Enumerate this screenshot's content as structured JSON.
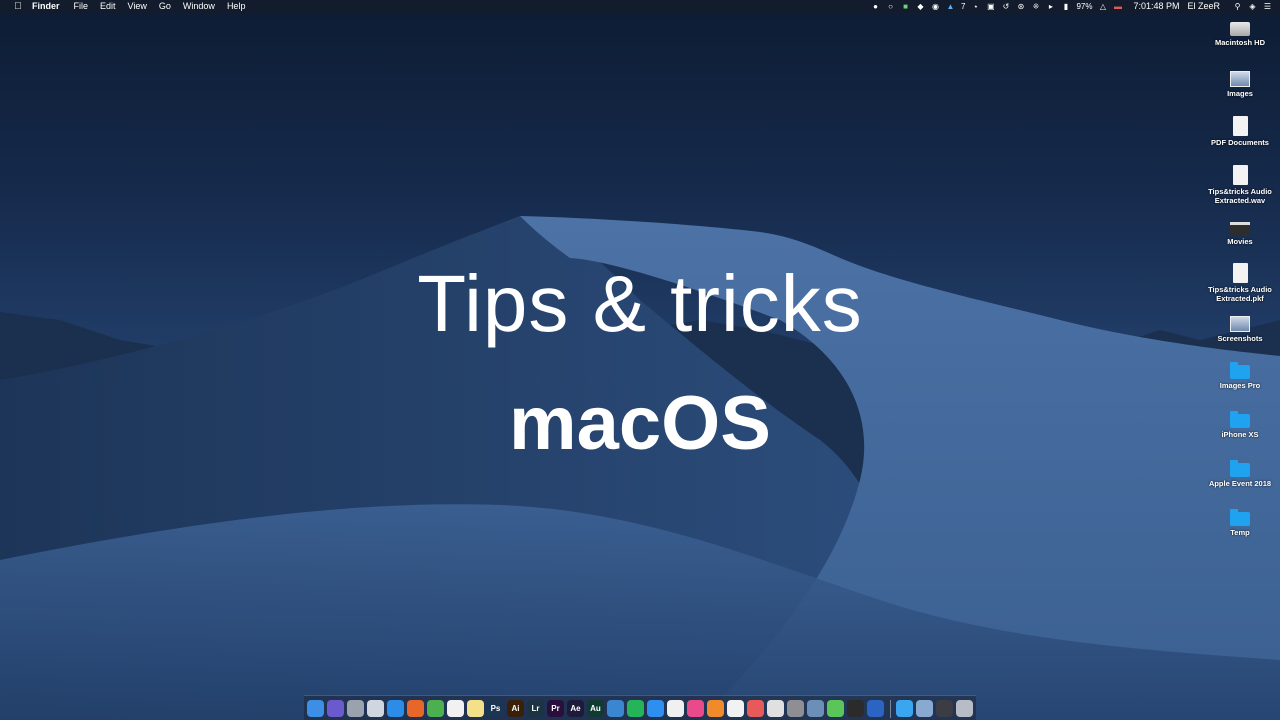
{
  "menubar": {
    "app_name": "Finder",
    "menus": [
      "File",
      "Edit",
      "View",
      "Go",
      "Window",
      "Help"
    ],
    "status": {
      "badge_count": "7",
      "battery_percent": "97%",
      "time": "7:01:48 PM",
      "user": "El ZeeR"
    }
  },
  "headline": {
    "line1": "Tips & tricks",
    "line2": "macOS"
  },
  "desktop_icons": [
    {
      "label": "Macintosh HD",
      "icon": "drive-icon"
    },
    {
      "label": "Images",
      "icon": "image-icon"
    },
    {
      "label": "PDF Documents",
      "icon": "document-icon"
    },
    {
      "label": "Tips&tricks Audio Extracted.wav",
      "icon": "audio-file-icon"
    },
    {
      "label": "Movies",
      "icon": "movie-icon"
    },
    {
      "label": "Tips&tricks Audio Extracted.pkf",
      "icon": "document-icon"
    },
    {
      "label": "Screenshots",
      "icon": "screenshot-icon"
    },
    {
      "label": "Images Pro",
      "icon": "folder-icon"
    },
    {
      "label": "iPhone XS",
      "icon": "folder-icon"
    },
    {
      "label": "Apple Event 2018",
      "icon": "folder-icon"
    },
    {
      "label": "Temp",
      "icon": "folder-icon"
    }
  ],
  "dock": {
    "apps": [
      {
        "name": "finder",
        "color": "#3d8fe6",
        "text": ""
      },
      {
        "name": "siri",
        "color": "#6a5acd",
        "text": ""
      },
      {
        "name": "launchpad",
        "color": "#9aa3ad",
        "text": ""
      },
      {
        "name": "mail",
        "color": "#d0d6df",
        "text": ""
      },
      {
        "name": "safari",
        "color": "#2c8de8",
        "text": ""
      },
      {
        "name": "firefox",
        "color": "#e8662a",
        "text": ""
      },
      {
        "name": "chrome",
        "color": "#4caf50",
        "text": ""
      },
      {
        "name": "calendar",
        "color": "#f1f1f1",
        "text": ""
      },
      {
        "name": "notes",
        "color": "#f5e08a",
        "text": ""
      },
      {
        "name": "photoshop",
        "color": "#1b3553",
        "text": "Ps"
      },
      {
        "name": "illustrator",
        "color": "#3b2009",
        "text": "Ai"
      },
      {
        "name": "lightroom",
        "color": "#1c3344",
        "text": "Lr"
      },
      {
        "name": "premiere",
        "color": "#2a0f3d",
        "text": "Pr"
      },
      {
        "name": "after-effects",
        "color": "#1e1a3b",
        "text": "Ae"
      },
      {
        "name": "audition",
        "color": "#0f3b33",
        "text": "Au"
      },
      {
        "name": "tweetbot",
        "color": "#3b86d1",
        "text": ""
      },
      {
        "name": "whatsapp",
        "color": "#25b45a",
        "text": ""
      },
      {
        "name": "app-store",
        "color": "#2f8ff0",
        "text": ""
      },
      {
        "name": "photos",
        "color": "#f0f0f0",
        "text": ""
      },
      {
        "name": "itunes",
        "color": "#e94a8a",
        "text": ""
      },
      {
        "name": "books",
        "color": "#f08a2a",
        "text": ""
      },
      {
        "name": "reminders",
        "color": "#f2f2f2",
        "text": ""
      },
      {
        "name": "skitch",
        "color": "#e85a5a",
        "text": ""
      },
      {
        "name": "preview",
        "color": "#e0e0e0",
        "text": ""
      },
      {
        "name": "system-preferences",
        "color": "#8e8e93",
        "text": ""
      },
      {
        "name": "finder-extras",
        "color": "#6c8fb8",
        "text": ""
      },
      {
        "name": "messages",
        "color": "#5ac65a",
        "text": ""
      },
      {
        "name": "terminal",
        "color": "#2b2b2b",
        "text": ""
      },
      {
        "name": "xcode",
        "color": "#2b64c2",
        "text": ""
      }
    ],
    "right": [
      {
        "name": "applications-folder",
        "color": "#3aa6f0"
      },
      {
        "name": "downloads-stack",
        "color": "#88a9d0"
      },
      {
        "name": "recent-stack",
        "color": "#3c3c44"
      },
      {
        "name": "trash",
        "color": "#b8bcc4"
      }
    ]
  }
}
